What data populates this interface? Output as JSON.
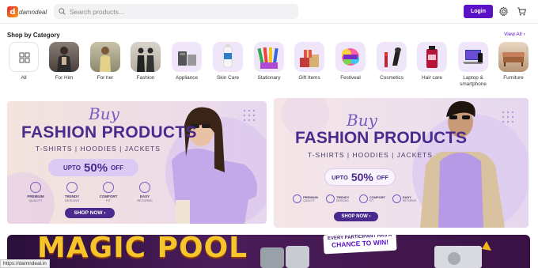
{
  "header": {
    "logo_text": "damndeal",
    "search_placeholder": "Search products...",
    "login_label": "Login"
  },
  "categories_section": {
    "title": "Shop by Category",
    "view_all": "View All ›",
    "items": [
      {
        "label": "All"
      },
      {
        "label": "For Him"
      },
      {
        "label": "For her"
      },
      {
        "label": "Fashion"
      },
      {
        "label": "Appliance"
      },
      {
        "label": "Skin Care"
      },
      {
        "label": "Stationary"
      },
      {
        "label": "Gift Items"
      },
      {
        "label": "Festiveal"
      },
      {
        "label": "Cosmetics"
      },
      {
        "label": "Hair care"
      },
      {
        "label": "Laptop &\nsmartphone"
      },
      {
        "label": "Furniture"
      }
    ]
  },
  "banners": [
    {
      "script": "Buy",
      "title": "FASHION PRODUCTS",
      "subtitle": "T-SHIRTS | HOODIES | JACKETS",
      "offer_prefix": "UPTO",
      "offer_value": "50%",
      "offer_suffix": "OFF",
      "features": [
        {
          "l1": "PREMIUM",
          "l2": "QUALITY"
        },
        {
          "l1": "TRENDY",
          "l2": "DESIGNS"
        },
        {
          "l1": "COMFORT",
          "l2": "FIT"
        },
        {
          "l1": "EASY",
          "l2": "RETURNS"
        }
      ],
      "cta": "SHOP NOW ›"
    },
    {
      "script": "Buy",
      "title": "FASHION PRODUCTS",
      "subtitle": "T-SHIRTS | HOODIES | JACKETS",
      "offer_prefix": "UPTO",
      "offer_value": "50%",
      "offer_suffix": "OFF",
      "features": [
        {
          "l1": "PREMIUM",
          "l2": "QUALITY"
        },
        {
          "l1": "TRENDY",
          "l2": "DESIGNS"
        },
        {
          "l1": "COMFORT",
          "l2": "FIT"
        },
        {
          "l1": "EASY",
          "l2": "RETURNS"
        }
      ],
      "cta": "SHOP NOW ›"
    }
  ],
  "promo": {
    "title": "MAGIC POOL",
    "tag_line1": "EVERY PARTICIPANT HAS A",
    "tag_line2": "CHANCE TO WIN!"
  },
  "status_bar": {
    "url": "https://damndeal.in"
  },
  "colors": {
    "brand_purple": "#5b12c7",
    "banner_title": "#4a2a8c"
  }
}
